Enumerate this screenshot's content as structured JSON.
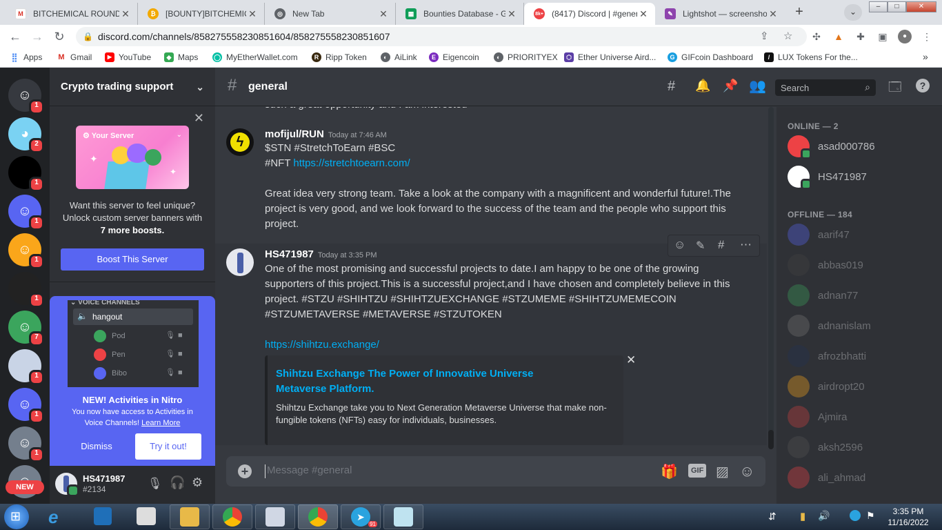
{
  "browser": {
    "tabs": [
      {
        "title": "BITCHEMICAL ROUND",
        "favicon": "gmail-icon",
        "active": false
      },
      {
        "title": "[BOUNTY]BITCHEMICAL",
        "favicon": "bitcoin-icon",
        "active": false
      },
      {
        "title": "New Tab",
        "favicon": "chrome-icon",
        "active": false
      },
      {
        "title": "Bounties Database - Go",
        "favicon": "sheets-icon",
        "active": false
      },
      {
        "title": "(8417) Discord | #gener",
        "favicon": "discord-icon",
        "active": true
      },
      {
        "title": "Lightshot — screensho",
        "favicon": "lightshot-icon",
        "active": false
      }
    ],
    "discord_tab_badge": "8k+",
    "url": "discord.com/channels/858275558230851604/858275558230851607",
    "bookmarks": [
      "Apps",
      "Gmail",
      "YouTube",
      "Maps",
      "MyEtherWallet.com",
      "Ripp Token",
      "AiLink",
      "Eigencoin",
      "PRIORITYEX",
      "Ether Universe Aird...",
      "GIFcoin Dashboard",
      "LUX Tokens For the..."
    ]
  },
  "guilds": [
    {
      "name": "discord-home-icon",
      "badge": "1",
      "color": "#36393f"
    },
    {
      "name": "blue-face-server-icon",
      "badge": "2",
      "color": "#7ad2f3"
    },
    {
      "name": "black-server-icon",
      "badge": "1",
      "color": "#000000"
    },
    {
      "name": "discord-server-icon",
      "badge": "1",
      "color": "#5865f2"
    },
    {
      "name": "discord-server-icon",
      "badge": "1",
      "color": "#faa61a"
    },
    {
      "name": "image-server-icon",
      "badge": "1",
      "color": "#222222"
    },
    {
      "name": "discord-server-icon",
      "badge": "7",
      "color": "#3ba55d"
    },
    {
      "name": "image-server-icon",
      "badge": "1",
      "color": "#c9d4e6"
    },
    {
      "name": "discord-server-icon",
      "badge": "1",
      "color": "#5865f2"
    },
    {
      "name": "discord-server-icon",
      "badge": "1",
      "color": "#747f8d"
    },
    {
      "name": "discord-server-icon",
      "badge": "",
      "color": "#747f8d"
    }
  ],
  "new_badge": "NEW",
  "sidebar": {
    "server_name": "Crypto trading support",
    "promo": {
      "banner_label": "Your Server",
      "line1": "Want this server to feel unique?",
      "line2": "Unlock custom server banners with",
      "line3": "7 more boosts.",
      "boost_button": "Boost This Server"
    },
    "nitro": {
      "section_label": "VOICE CHANNELS",
      "channel": "hangout",
      "users": [
        "Pod",
        "Pen",
        "Bibo"
      ],
      "title": "NEW! Activities in Nitro",
      "desc1": "You now have access to Activities in",
      "desc2": "Voice Channels!",
      "learn_more": "Learn More",
      "dismiss": "Dismiss",
      "try_it": "Try it out!"
    },
    "user": {
      "name": "HS471987",
      "tag": "#2134"
    }
  },
  "chat": {
    "channel": "general",
    "search_placeholder": "Search",
    "prev_line": "such a great opportunity and I am interested",
    "messages": [
      {
        "author": "mofijul/RUN",
        "time": "Today at 7:46 AM",
        "line1": "$STN #StretchToEarn  #BSC",
        "line2_prefix": "#NFT ",
        "line2_link": "https://stretchtoearn.com/",
        "body": "Great idea very strong team. Take a look at the company with a magnificent and wonderful future!.The project is very good, and we look forward to the success of the team and the people who support this project."
      },
      {
        "author": "HS471987",
        "time": "Today at 3:35 PM",
        "body": "One of the most promising and successful projects to date.I am happy to be one of the growing supporters of this project.This is a successful project,and I have chosen and completely believe in this project. #STZU #SHIHTZU #SHIHTZUEXCHANGE #STZUMEME #SHIHTZUMEMECOIN #STZUMETAVERSE #METAVERSE #STZUTOKEN",
        "link": "https://shihtzu.exchange/",
        "embed_title": "Shihtzu Exchange The Power of Innovative Universe Metaverse Platform.",
        "embed_desc": "Shihtzu Exchange take you to Next Generation Metaverse Universe that make non-fungible tokens (NFTs) easy for individuals, businesses."
      }
    ],
    "composer_placeholder": "Message #general",
    "gif_label": "GIF"
  },
  "members": {
    "online_header": "ONLINE — 2",
    "online": [
      {
        "name": "asad000786",
        "color": "#ed4245"
      },
      {
        "name": "HS471987",
        "color": "#ffffff"
      }
    ],
    "offline_header": "OFFLINE — 184",
    "offline": [
      {
        "name": "aarif47",
        "color": "#5865f2"
      },
      {
        "name": "abbas019",
        "color": "#444444"
      },
      {
        "name": "adnan77",
        "color": "#3ba55d"
      },
      {
        "name": "adnanislam",
        "color": "#777777"
      },
      {
        "name": "afrozbhatti",
        "color": "#223355"
      },
      {
        "name": "airdropt20",
        "color": "#faa61a"
      },
      {
        "name": "Ajmira",
        "color": "#d04040"
      },
      {
        "name": "aksh2596",
        "color": "#555555"
      },
      {
        "name": "ali_ahmad",
        "color": "#ed4245"
      }
    ]
  },
  "taskbar": {
    "time": "3:35 PM",
    "date": "11/16/2022",
    "telegram_badge": "91"
  }
}
